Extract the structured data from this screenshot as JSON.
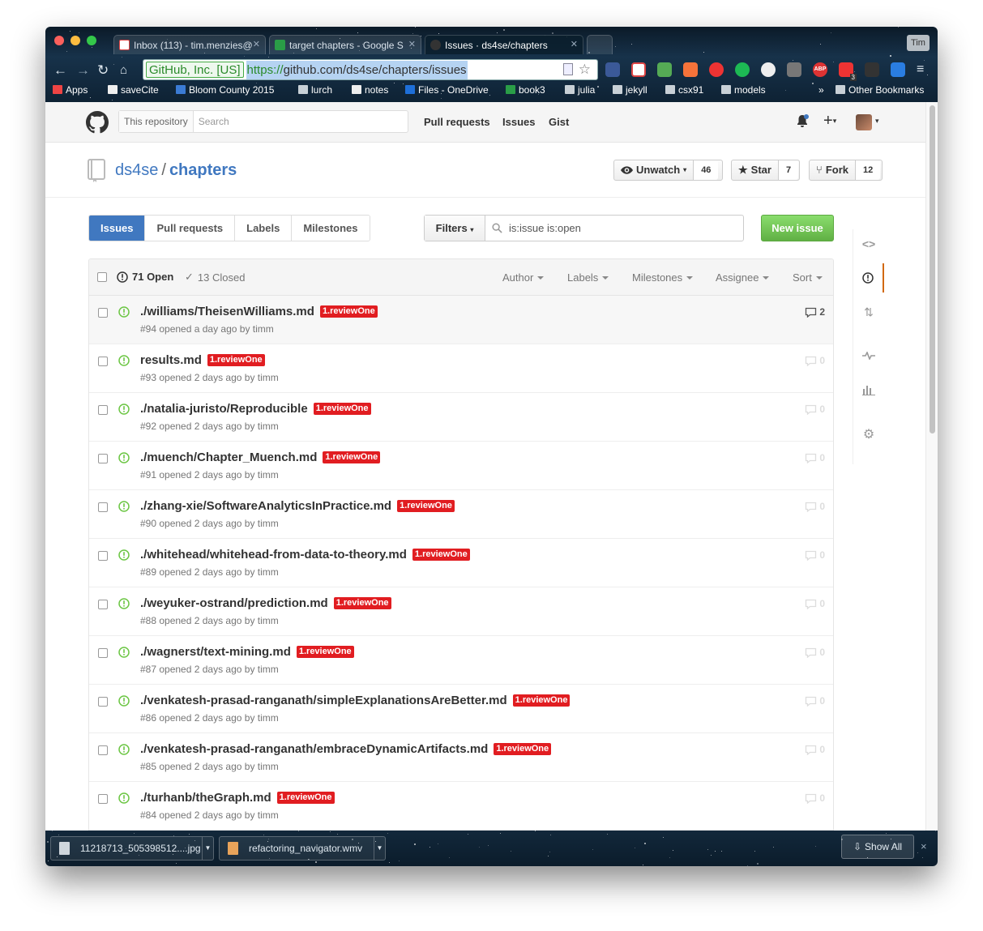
{
  "browser": {
    "tabs": [
      {
        "label": "Inbox (113) - tim.menzies@",
        "icon_color": "#d44"
      },
      {
        "label": "target chapters - Google S",
        "icon_color": "#2a9d47"
      },
      {
        "label": "Issues · ds4se/chapters",
        "icon_color": "#222"
      }
    ],
    "user_button": "Tim",
    "ev_badge": "GitHub, Inc. [US]",
    "url_scheme": "https://",
    "url_rest": "github.com/ds4se/chapters/issues",
    "extensions": [
      "facebook-icon",
      "gmail-icon",
      "evernote-icon",
      "addthis-icon",
      "ladybug-icon",
      "spotify-icon",
      "clock-icon",
      "hand-icon",
      "adblock-icon",
      "red-badge-icon",
      "graduation-cap-icon",
      "dropbox-icon",
      "menu-icon"
    ],
    "ext_badge": "3",
    "adblock_text": "ABP",
    "bookmarks": [
      {
        "label": "Apps",
        "color": "#e44"
      },
      {
        "label": "saveCite",
        "color": "#eee"
      },
      {
        "label": "Bloom County 2015",
        "color": "#3b7bd4"
      },
      {
        "label": "lurch",
        "color": "#c8d0d6"
      },
      {
        "label": "notes",
        "color": "#eee"
      },
      {
        "label": "Files - OneDrive",
        "color": "#1e6fd8"
      },
      {
        "label": "book3",
        "color": "#2a9d47"
      },
      {
        "label": "julia",
        "color": "#c8d0d6"
      },
      {
        "label": "jekyll",
        "color": "#c8d0d6"
      },
      {
        "label": "csx91",
        "color": "#c8d0d6"
      },
      {
        "label": "models",
        "color": "#c8d0d6"
      }
    ],
    "bookmarks_overflow": "»",
    "other_bookmarks": "Other Bookmarks"
  },
  "github": {
    "search_scope": "This repository",
    "search_placeholder": "Search",
    "header_links": [
      "Pull requests",
      "Issues",
      "Gist"
    ],
    "repo_owner": "ds4se",
    "repo_sep": "/",
    "repo_name": "chapters",
    "watch_label": "Unwatch",
    "watch_count": "46",
    "star_label": "Star",
    "star_count": "7",
    "fork_label": "Fork",
    "fork_count": "12",
    "subnav": [
      "Issues",
      "Pull requests",
      "Labels",
      "Milestones"
    ],
    "filters_label": "Filters",
    "filter_query": "is:issue is:open",
    "new_issue": "New issue",
    "open_count": "71 Open",
    "closed_count": "13 Closed",
    "list_filters": [
      "Author",
      "Labels",
      "Milestones",
      "Assignee",
      "Sort"
    ],
    "label_color": "#e11d21",
    "issues": [
      {
        "title": "./williams/TheisenWilliams.md",
        "label": "1.reviewOne",
        "meta": "#94 opened a day ago by timm",
        "comments": "2"
      },
      {
        "title": "results.md",
        "label": "1.reviewOne",
        "meta": "#93 opened 2 days ago by timm",
        "comments": "0"
      },
      {
        "title": "./natalia-juristo/Reproducible",
        "label": "1.reviewOne",
        "meta": "#92 opened 2 days ago by timm",
        "comments": "0"
      },
      {
        "title": "./muench/Chapter_Muench.md",
        "label": "1.reviewOne",
        "meta": "#91 opened 2 days ago by timm",
        "comments": "0"
      },
      {
        "title": "./zhang-xie/SoftwareAnalyticsInPractice.md",
        "label": "1.reviewOne",
        "meta": "#90 opened 2 days ago by timm",
        "comments": "0"
      },
      {
        "title": "./whitehead/whitehead-from-data-to-theory.md",
        "label": "1.reviewOne",
        "meta": "#89 opened 2 days ago by timm",
        "comments": "0"
      },
      {
        "title": "./weyuker-ostrand/prediction.md",
        "label": "1.reviewOne",
        "meta": "#88 opened 2 days ago by timm",
        "comments": "0"
      },
      {
        "title": "./wagnerst/text-mining.md",
        "label": "1.reviewOne",
        "meta": "#87 opened 2 days ago by timm",
        "comments": "0"
      },
      {
        "title": "./venkatesh-prasad-ranganath/simpleExplanationsAreBetter.md",
        "label": "1.reviewOne",
        "meta": "#86 opened 2 days ago by timm",
        "comments": "0"
      },
      {
        "title": "./venkatesh-prasad-ranganath/embraceDynamicArtifacts.md",
        "label": "1.reviewOne",
        "meta": "#85 opened 2 days ago by timm",
        "comments": "0"
      },
      {
        "title": "./turhanb/theGraph.md",
        "label": "1.reviewOne",
        "meta": "#84 opened 2 days ago by timm",
        "comments": "0"
      }
    ],
    "sidenav": [
      "code-icon",
      "issues-icon",
      "pull-request-icon",
      "pulse-icon",
      "graphs-icon",
      "settings-icon"
    ]
  },
  "downloads": {
    "items": [
      "11218713_505398512....jpg",
      "refactoring_navigator.wmv"
    ],
    "show_all": "Show All",
    "close": "×"
  }
}
